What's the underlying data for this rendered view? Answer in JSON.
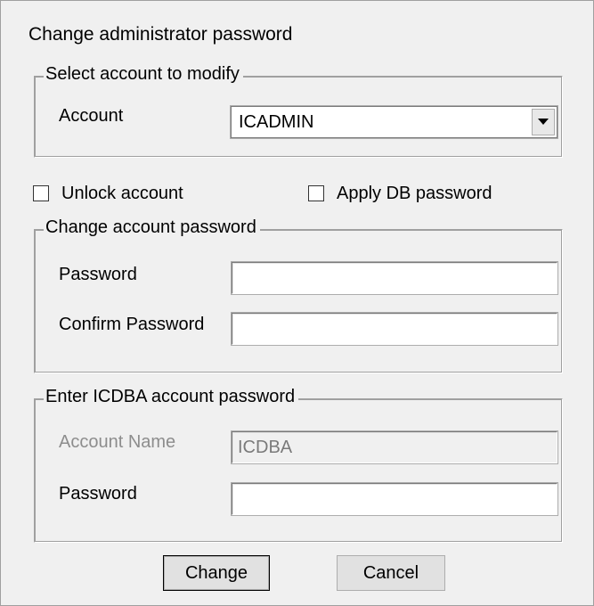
{
  "dialog": {
    "title": "Change administrator password"
  },
  "select_account": {
    "legend": "Select account to modify",
    "account_label": "Account",
    "account_value": "ICADMIN"
  },
  "options": {
    "unlock_label": "Unlock account",
    "unlock_checked": false,
    "apply_db_label": "Apply DB password",
    "apply_db_checked": false
  },
  "change_password": {
    "legend": "Change account password",
    "password_label": "Password",
    "password_value": "",
    "confirm_label": "Confirm Password",
    "confirm_value": ""
  },
  "icdba": {
    "legend": "Enter ICDBA account password",
    "account_name_label": "Account Name",
    "account_name_value": "ICDBA",
    "password_label": "Password",
    "password_value": ""
  },
  "buttons": {
    "change": "Change",
    "cancel": "Cancel"
  },
  "icons": {
    "dropdown": "chevron-down-icon"
  }
}
